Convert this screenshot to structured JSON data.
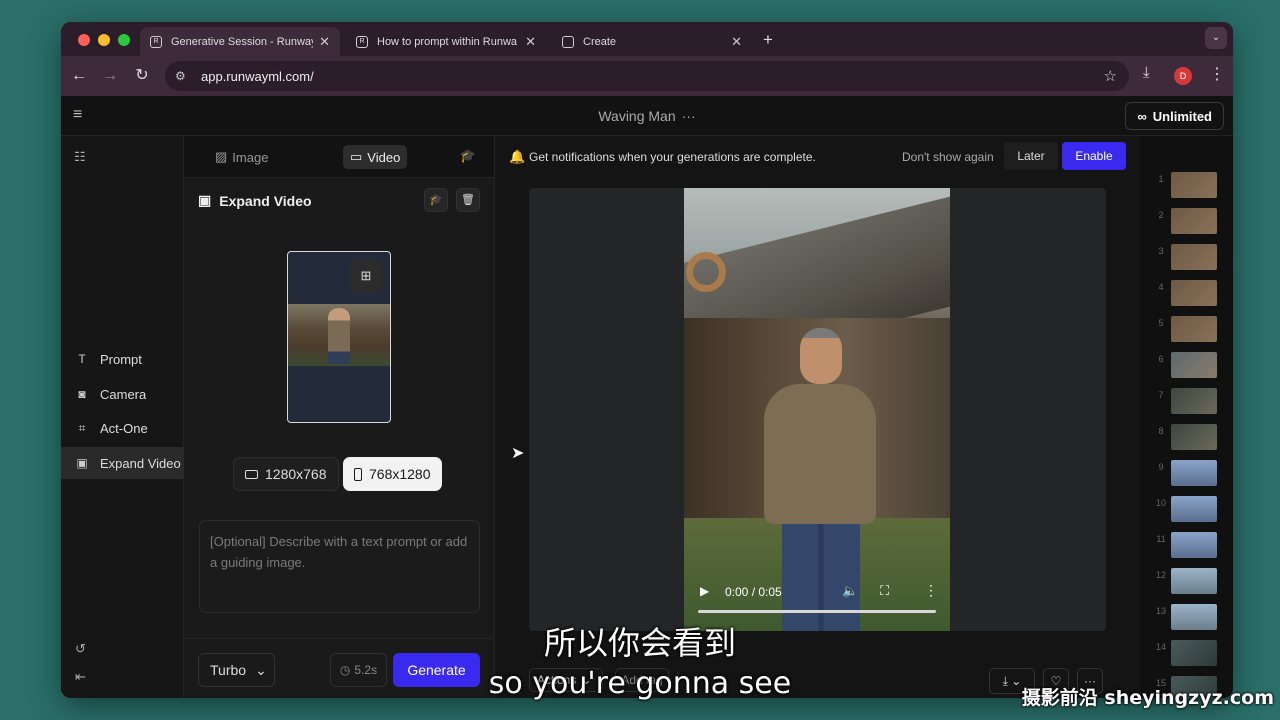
{
  "browser": {
    "tabs": [
      {
        "title": "Generative Session - Runway",
        "active": true
      },
      {
        "title": "How to prompt within Runwa",
        "active": false
      },
      {
        "title": "Create",
        "active": false
      }
    ],
    "url": "app.runwayml.com/",
    "profile_initial": "D"
  },
  "app": {
    "project_title": "Waving Man",
    "plan_label": "Unlimited"
  },
  "rail": {
    "items": [
      {
        "label": "Prompt",
        "icon": "text-icon"
      },
      {
        "label": "Camera",
        "icon": "camera-icon"
      },
      {
        "label": "Act-One",
        "icon": "face-scan-icon"
      },
      {
        "label": "Expand Video",
        "icon": "expand-icon",
        "active": true
      }
    ]
  },
  "modes": {
    "image": "Image",
    "video": "Video",
    "active": "Video"
  },
  "panel": {
    "title": "Expand Video",
    "ratios": [
      {
        "label": "1280x768",
        "selected": false
      },
      {
        "label": "768x1280",
        "selected": true
      }
    ],
    "prompt_placeholder": "[Optional] Describe with a text prompt or add a guiding image.",
    "model": "Turbo",
    "credits": "5.2s",
    "generate_label": "Generate"
  },
  "notification": {
    "message": "Get notifications when your generations are complete.",
    "dismiss": "Don't show again",
    "later": "Later",
    "enable": "Enable"
  },
  "player": {
    "time": "0:00 / 0:05",
    "actions_label": "Actions",
    "add_tag_label": "Add tag"
  },
  "history": {
    "numbers": [
      "1",
      "2",
      "3",
      "4",
      "5",
      "6",
      "7",
      "8",
      "9",
      "10",
      "11",
      "12",
      "13",
      "14",
      "15"
    ]
  },
  "subtitles": {
    "chinese": "所以你会看到",
    "english": "so you're gonna see"
  },
  "watermark": "摄影前沿 sheyingzyz.com",
  "colors": {
    "accent": "#3a2af0",
    "background": "#121212"
  }
}
